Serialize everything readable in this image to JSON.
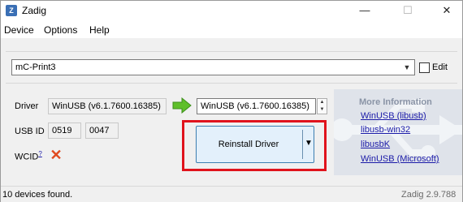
{
  "window": {
    "title": "Zadig",
    "app_icon": "Z"
  },
  "window_controls": {
    "minimize": "—",
    "maximize": "☐",
    "close": "✕"
  },
  "menu": {
    "items": [
      "Device",
      "Options",
      "Help"
    ]
  },
  "device_selector": {
    "value": "mC-Print3",
    "edit_label": "Edit",
    "edit_checked": false
  },
  "driver": {
    "label": "Driver",
    "current": "WinUSB (v6.1.7600.16385)",
    "target": "WinUSB (v6.1.7600.16385)"
  },
  "usb_id": {
    "label": "USB ID",
    "vid": "0519",
    "pid": "0047"
  },
  "wcid": {
    "label": "WCID",
    "help_marker": "?",
    "status_icon": "red-x-icon"
  },
  "action": {
    "label": "Reinstall Driver",
    "highlight_color": "#e0131c"
  },
  "more_info": {
    "title": "More Information",
    "links": [
      "WinUSB (libusb)",
      "libusb-win32",
      "libusbK",
      "WinUSB (Microsoft)"
    ]
  },
  "status": {
    "message": "10 devices found.",
    "version": "Zadig 2.9.788"
  }
}
